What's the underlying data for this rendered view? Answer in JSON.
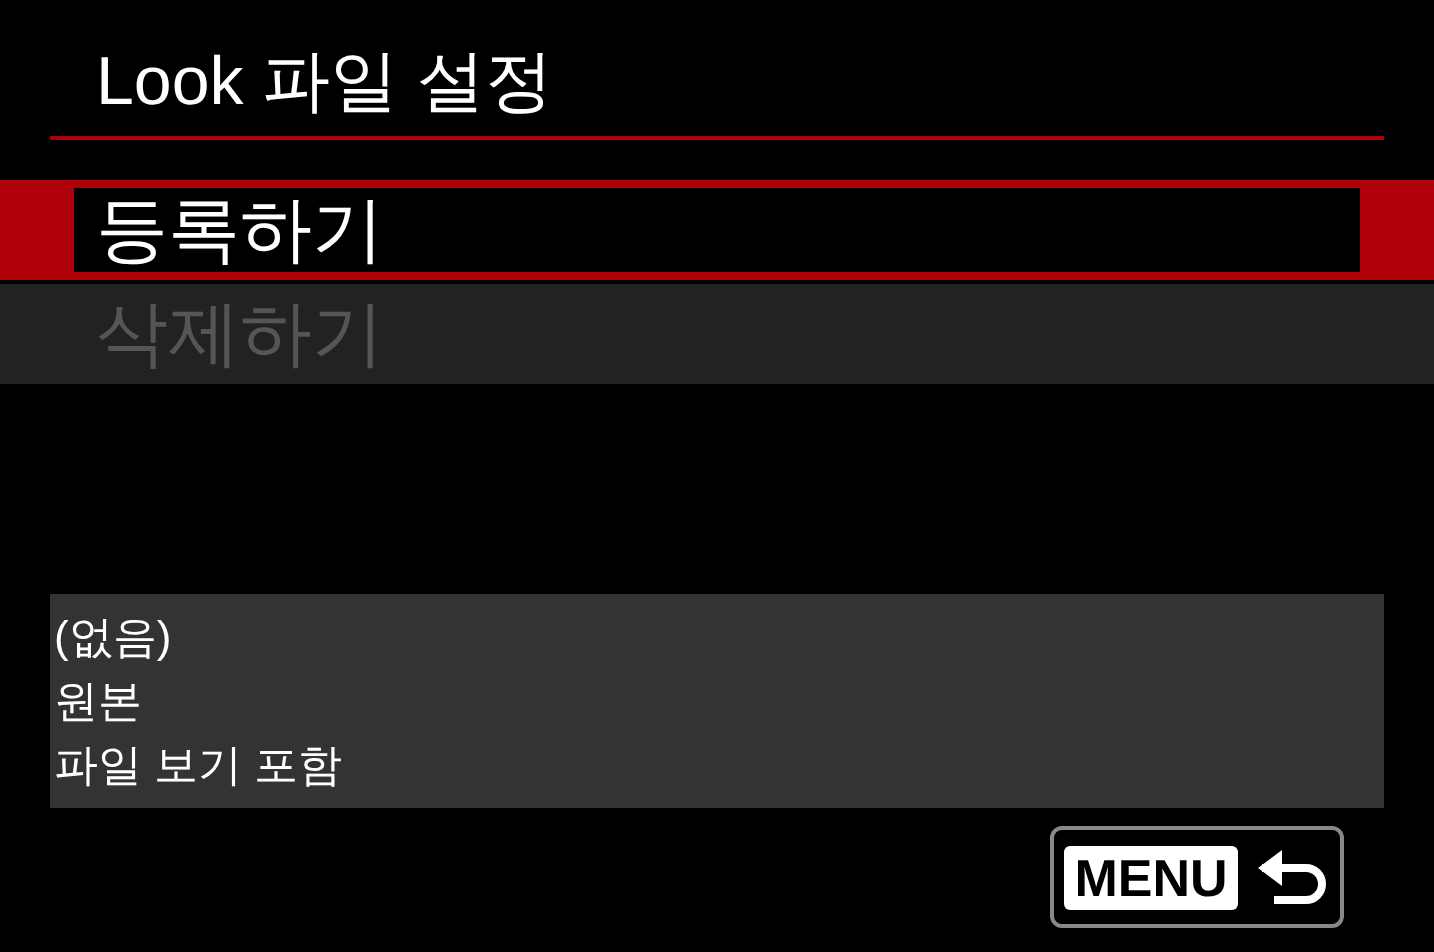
{
  "title": "Look 파일 설정",
  "menu_items": [
    {
      "label": "등록하기",
      "selected": true,
      "disabled": false
    },
    {
      "label": "삭제하기",
      "selected": false,
      "disabled": true
    }
  ],
  "info_lines": [
    "(없음)",
    "원본",
    "파일 보기 포함"
  ],
  "back_button": {
    "label": "MENU"
  }
}
